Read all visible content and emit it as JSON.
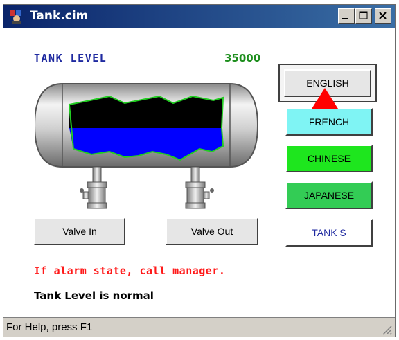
{
  "window": {
    "title": "Tank.cim",
    "controls": {
      "minimize": "minimize",
      "maximize": "maximize",
      "close": "close"
    }
  },
  "tank": {
    "level_label": "TANK LEVEL",
    "level_value": "35000",
    "colors": {
      "fill": "#0000ff",
      "empty": "#000000",
      "outline": "#22cc22"
    }
  },
  "valves": {
    "in_label": "Valve In",
    "out_label": "Valve Out"
  },
  "languages": {
    "english": "ENGLISH",
    "french": "FRENCH",
    "chinese": "CHINESE",
    "japanese": "JAPANESE",
    "tanks": "TANK S",
    "colors": {
      "french": "#7ff4f4",
      "chinese": "#1ee61e",
      "japanese": "#33cc55"
    }
  },
  "messages": {
    "alarm": "If alarm state, call manager.",
    "status": "Tank Level is normal"
  },
  "statusbar": {
    "help": "For Help, press F1"
  }
}
